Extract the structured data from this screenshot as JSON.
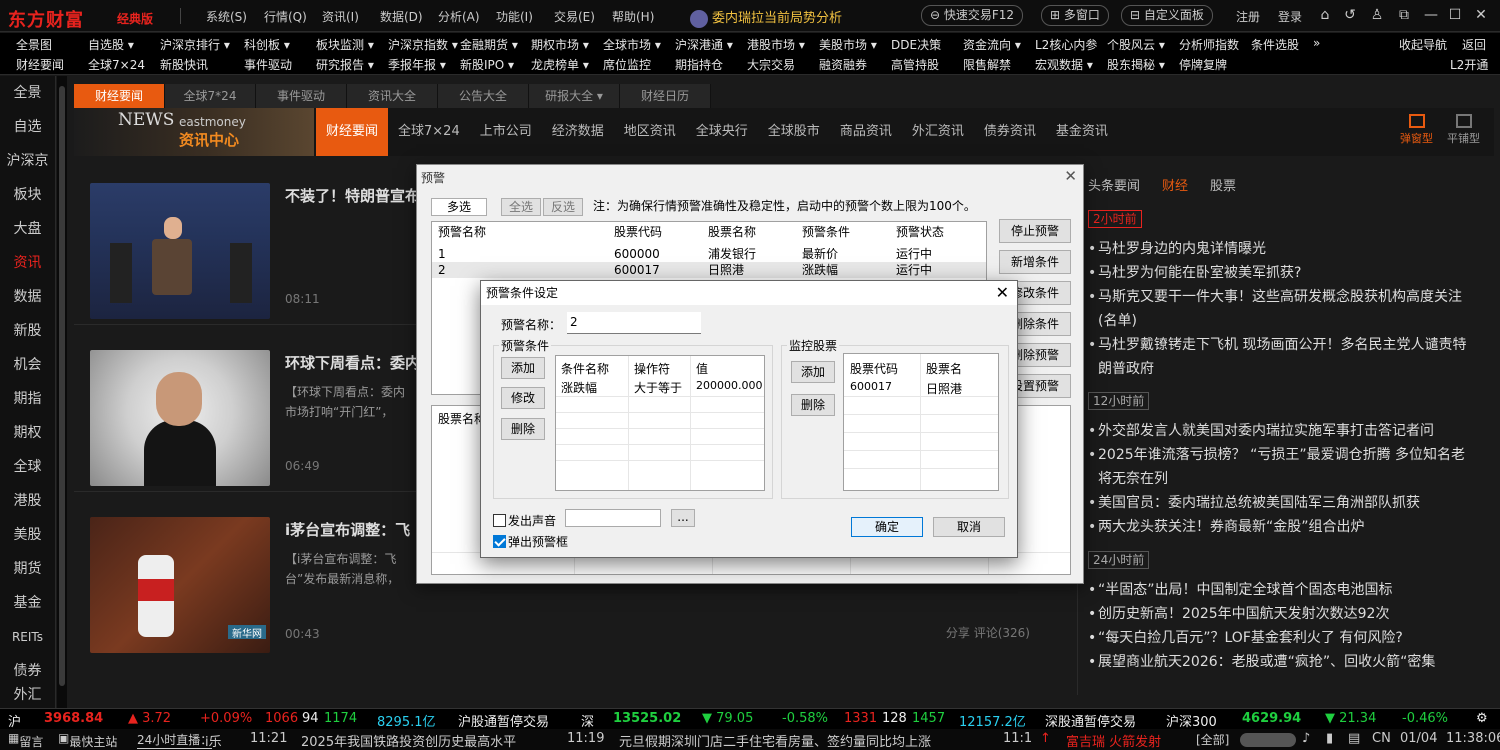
{
  "app": {
    "logo": "东方财富",
    "edition": "经典版",
    "menus": [
      "系统(S)",
      "行情(Q)",
      "资讯(I)",
      "数据(D)",
      "分析(A)",
      "功能(I)",
      "交易(E)",
      "帮助(H)"
    ],
    "ticker": "委内瑞拉当前局势分析",
    "quick_trade": "快速交易F12",
    "multi_window": "多窗口",
    "custom_panel": "自定义面板",
    "register": "注册",
    "login": "登录"
  },
  "nav": {
    "row1": [
      "全景图",
      "自选股 ▾",
      "沪深京排行 ▾",
      "科创板 ▾",
      "板块监测 ▾",
      "沪深京指数 ▾",
      "金融期货 ▾",
      "期权市场 ▾",
      "全球市场 ▾",
      "沪深港通 ▾",
      "港股市场 ▾",
      "美股市场 ▾",
      "DDE决策",
      "资金流向 ▾",
      "L2核心内参",
      "个股风云 ▾",
      "分析师指数",
      "条件选股",
      "»",
      "收起导航",
      "返回"
    ],
    "row2": [
      "财经要闻",
      "全球7×24",
      "新股快讯",
      "事件驱动",
      "研究报告 ▾",
      "季报年报 ▾",
      "新股IPO ▾",
      "龙虎榜单 ▾",
      "席位监控",
      "期指持仓",
      "大宗交易",
      "融资融券",
      "高管持股",
      "限售解禁",
      "宏观数据 ▾",
      "股东揭秘 ▾",
      "停牌复牌",
      "L2开通"
    ]
  },
  "sidebar": [
    "全景",
    "自选",
    "沪深京",
    "板块",
    "大盘",
    "资讯",
    "数据",
    "新股",
    "机会",
    "期指",
    "期权",
    "全球",
    "港股",
    "美股",
    "期货",
    "基金",
    "REITs",
    "债券",
    "外汇"
  ],
  "tabs": [
    "财经要闻",
    "全球7*24",
    "事件驱动",
    "资讯大全",
    "公告大全",
    "研报大全 ▾",
    "财经日历"
  ],
  "newsbar": {
    "banner_news": "NEWS",
    "banner_brand": "eastmoney",
    "banner_title": "资讯中心",
    "tabs": [
      "财经要闻",
      "全球7×24",
      "上市公司",
      "经济数据",
      "地区资讯",
      "全球央行",
      "全球股市",
      "商品资讯",
      "外汇资讯",
      "债券资讯",
      "基金资讯"
    ],
    "layout_a": "弹窗型",
    "layout_b": "平铺型"
  },
  "feed": [
    {
      "title": "不装了！特朗普宣布",
      "summary": "",
      "time": "08:11"
    },
    {
      "title": "环球下周看点：委内",
      "summary": "【环球下周看点：委内 市场打响“开门红”，",
      "time": "06:49"
    },
    {
      "title": "i茅台宣布调整：飞",
      "summary": "【i茅台宣布调整：飞 台”发布最新消息称，",
      "time": "00:43",
      "share": "分享",
      "comment": "评论(326)"
    }
  ],
  "right": {
    "tabs": [
      "头条要闻",
      "财经",
      "股票"
    ],
    "groups": [
      {
        "label": "2小时前",
        "items": [
          "马杜罗身边的内鬼详情曝光",
          "马杜罗为何能在卧室被美军抓获?",
          "马斯克又要干一件大事！这些高研发概念股获机构高度关注(名单)",
          "马杜罗戴镣铐走下飞机 现场画面公开！多名民主党人谴责特朗普政府"
        ]
      },
      {
        "label": "12小时前",
        "items": [
          "外交部发言人就美国对委内瑞拉实施军事打击答记者问",
          "2025年谁流落亏损榜？ “亏损王”最爱调仓折腾 多位知名老将无奈在列",
          "美国官员：委内瑞拉总统被美国陆军三角洲部队抓获",
          "两大龙头获关注！券商最新“金股”组合出炉"
        ]
      },
      {
        "label": "24小时前",
        "items": [
          "“半固态”出局！中国制定全球首个固态电池国标",
          "创历史新高！2025年中国航天发射次数达92次",
          "“每天白捡几百元”？LOF基金套利火了 有何风险?",
          "展望商业航天2026：老股或遭“疯抢”、回收火箭“密集"
        ]
      }
    ]
  },
  "alert_dialog": {
    "title": "预警",
    "multi": "多选",
    "select_all": "全选",
    "invert": "反选",
    "note": "注：为确保行情预警准确性及稳定性，启动中的预警个数上限为100个。",
    "columns": [
      "预警名称",
      "股票代码",
      "股票名称",
      "预警条件",
      "预警状态"
    ],
    "rows": [
      [
        "1",
        "600000",
        "浦发银行",
        "最新价",
        "运行中"
      ],
      [
        "2",
        "600017",
        "日照港",
        "涨跌幅",
        "运行中"
      ]
    ],
    "buttons": [
      "停止预警",
      "新增条件",
      "修改条件",
      "删除条件",
      "删除预警",
      "设置预警"
    ],
    "sub_column": "股票名称"
  },
  "cond_dialog": {
    "title": "预警条件设定",
    "name_label": "预警名称：",
    "name_value": "2",
    "cond_group": "预警条件",
    "cond_buttons": [
      "添加",
      "修改",
      "删除"
    ],
    "cond_columns": [
      "条件名称",
      "操作符",
      "值"
    ],
    "cond_rows": [
      [
        "涨跌幅",
        "大于等于",
        "200000.000"
      ]
    ],
    "watch_group": "监控股票",
    "watch_buttons": [
      "添加",
      "删除"
    ],
    "watch_columns": [
      "股票代码",
      "股票名"
    ],
    "watch_rows": [
      [
        "600017",
        "日照港"
      ]
    ],
    "sound": "发出声音",
    "popup": "弹出预警框",
    "browse": "...",
    "ok": "确定",
    "cancel": "取消"
  },
  "status1": {
    "sh": "沪",
    "sh_idx": "3968.84",
    "sh_chg": "▲ 3.72",
    "sh_pct": "+0.09%",
    "sh_up": "1066",
    "sh_flat": "94",
    "sh_dn": "1174",
    "sh_amt": "8295.1亿",
    "hk_sh": "沪股通暂停交易",
    "sz": "深",
    "sz_idx": "13525.02",
    "sz_chg": "▼ 79.05",
    "sz_pct": "-0.58%",
    "sz_up": "1331",
    "sz_flat": "128",
    "sz_dn": "1457",
    "sz_amt": "12157.2亿",
    "hk_sz": "深股通暂停交易",
    "hs300": "沪深300",
    "hs300_idx": "4629.94",
    "hs300_chg": "▼ 21.34",
    "hs300_pct": "-0.46%"
  },
  "status2": {
    "leave": "留言",
    "fast": "最快主站",
    "live": "24小时直播：",
    "live_tail": "i乐",
    "n1_time": "11:21",
    "n1": "2025年我国铁路投资创历史最高水平",
    "n2_time": "11:19",
    "n2": "元旦假期深圳门店二手住宅看房量、签约量同比均上涨",
    "n3_time": "11:1",
    "alert": "富吉瑞 火箭发射",
    "all": "[全部]",
    "lang": "CN",
    "date": "01/04",
    "clock": "11:38:06"
  },
  "colors": {
    "accent": "#e85a10",
    "up": "#e8231e",
    "down": "#1fcf3f",
    "amount": "#2ad0f0"
  }
}
